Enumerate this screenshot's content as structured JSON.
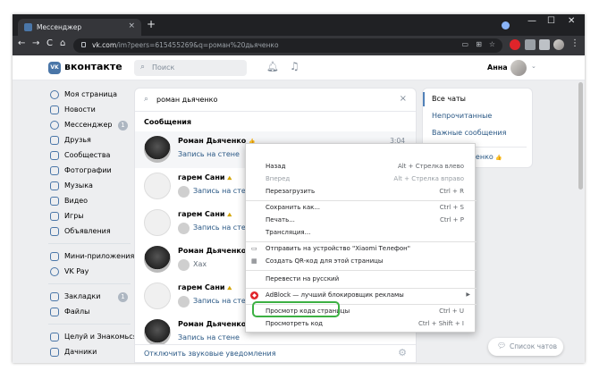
{
  "browser": {
    "tab_title": "Мессенджер",
    "tab_close": "×",
    "new_tab": "+",
    "url_host": "vk.com",
    "url_path": "/im?peers=615455269&q=роман%20дьяченко",
    "controls": {
      "minimize": "—",
      "maximize": "☐",
      "close": "✕"
    },
    "nav": {
      "back": "←",
      "forward": "→",
      "reload": "C",
      "home": "⌂"
    }
  },
  "vk_header": {
    "logo_text": "VK",
    "brand": "вконтакте",
    "search_placeholder": "Поиск",
    "user_name": "Анна"
  },
  "menu": {
    "items": [
      {
        "label": "Моя страница"
      },
      {
        "label": "Новости"
      },
      {
        "label": "Мессенджер",
        "badge": "1"
      },
      {
        "label": "Друзья"
      },
      {
        "label": "Сообщества"
      },
      {
        "label": "Фотографии"
      },
      {
        "label": "Музыка"
      },
      {
        "label": "Видео"
      },
      {
        "label": "Игры"
      },
      {
        "label": "Объявления"
      }
    ],
    "items2": [
      {
        "label": "Мини-приложения"
      },
      {
        "label": "VK Pay"
      }
    ],
    "items3": [
      {
        "label": "Закладки",
        "badge": "1"
      },
      {
        "label": "Файлы"
      }
    ],
    "items4": [
      {
        "label": "Целуй и Знакомься"
      },
      {
        "label": "Дачники"
      }
    ]
  },
  "messages": {
    "search_query": "роман дьяченко",
    "section_title": "Сообщения",
    "items": [
      {
        "name": "Роман Дьяченко",
        "emoji": "👍",
        "snippet": "Запись на стене",
        "time": "3:04"
      },
      {
        "name": "гарем Сани",
        "emoji": "⛰",
        "snippet": "Запись на стене"
      },
      {
        "name": "гарем Сани",
        "emoji": "⛰",
        "snippet": "Запись на стене"
      },
      {
        "name": "Роман Дьяченко",
        "emoji": "👍",
        "snippet": "Хах"
      },
      {
        "name": "гарем Сани",
        "emoji": "⛰",
        "snippet": "Запись на стене"
      },
      {
        "name": "Роман Дьяченко",
        "emoji": "👍",
        "snippet": "Запись на стене"
      }
    ],
    "footer_link": "Отключить звуковые уведомления"
  },
  "filters": {
    "all": "Все чаты",
    "unread": "Непрочитанные",
    "important": "Важные сообщения",
    "contact": "Роман Дьяченко"
  },
  "chat_button": "Список чатов",
  "context_menu": {
    "items": [
      {
        "label": "Назад",
        "shortcut": "Alt + Стрелка влево"
      },
      {
        "label": "Вперед",
        "shortcut": "Alt + Стрелка вправо"
      },
      {
        "label": "Перезагрузить",
        "shortcut": "Ctrl + R"
      },
      {
        "label": "Сохранить как...",
        "shortcut": "Ctrl + S"
      },
      {
        "label": "Печать...",
        "shortcut": "Ctrl + P"
      },
      {
        "label": "Трансляция..."
      },
      {
        "label": "Отправить на устройство \"Xiaomi Телефон\""
      },
      {
        "label": "Создать QR-код для этой страницы"
      },
      {
        "label": "Перевести на русский"
      },
      {
        "label": "AdBlock — лучший блокировщик рекламы"
      },
      {
        "label": "Просмотр кода страницы",
        "shortcut": "Ctrl + U"
      },
      {
        "label": "Просмотреть код",
        "shortcut": "Ctrl + Shift + I"
      }
    ]
  },
  "colors": {
    "accent": "#4a76a8",
    "highlight": "#3cb043",
    "link": "#2a5885"
  }
}
